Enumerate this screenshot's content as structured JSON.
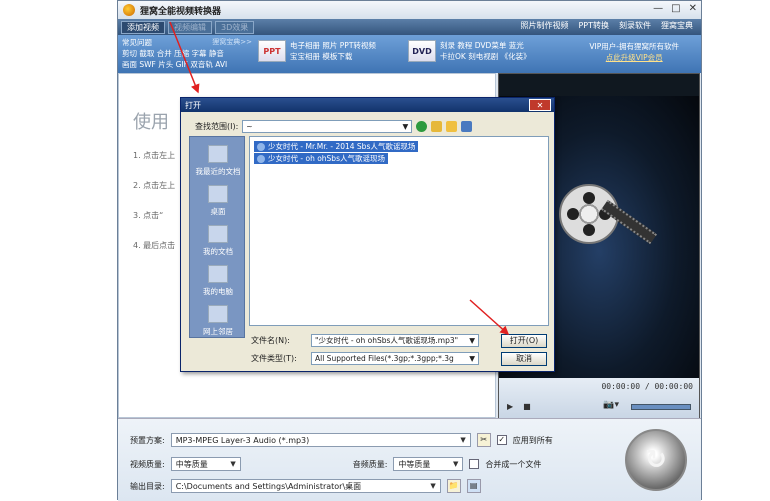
{
  "window": {
    "title": "狸窝全能视频转换器",
    "controls": [
      "—",
      "□",
      "✕"
    ]
  },
  "tabs": [
    {
      "label": "添加视频"
    },
    {
      "label": "视频编辑"
    },
    {
      "label": "3D效果"
    }
  ],
  "top_links": [
    "照片制作视频",
    "PPT转换",
    "刻录软件",
    "狸窝宝典"
  ],
  "banner": {
    "faq_title": "常见问题",
    "faq_more": "狸窝宝典>>",
    "faq_lines": [
      "剪切 截取 合并 压缩 字幕 静音",
      "画面 SWF 片头 GIF 双音轨 AVI"
    ],
    "promo1": {
      "icon": "PPT",
      "lines": [
        "电子相册 照片 PPT转视频",
        "宝宝相册 模板下载"
      ]
    },
    "promo2": {
      "icon": "DVD",
      "lines": [
        "刻录 教程 DVD菜单 蓝光",
        "卡拉OK 刻电视剧 《化装》"
      ]
    },
    "vip": {
      "line1": "VIP用户-拥有狸窝所有软件",
      "line2": "点此升级VIP会员"
    }
  },
  "left": {
    "title": "使用",
    "steps": [
      "1. 点击左上",
      "2. 点击左上",
      "3. 点击“",
      "4. 最后点击"
    ]
  },
  "player": {
    "time": "00:00:00 / 00:00:00",
    "play": "▶",
    "stop": "■",
    "camera": "📷▾"
  },
  "bottom": {
    "preset_label": "预置方案:",
    "preset_value": "MP3-MPEG Layer-3 Audio (*.mp3)",
    "apply_all": "应用到所有",
    "video_quality_label": "视频质量:",
    "video_quality_value": "中等质量",
    "audio_quality_label": "音频质量:",
    "audio_quality_value": "中等质量",
    "merge_label": "合并成一个文件",
    "output_label": "输出目录:",
    "output_value": "C:\\Documents and Settings\\Administrator\\桌面"
  },
  "dialog": {
    "title": "打开",
    "close": "✕",
    "lookin_label": "查找范围(I):",
    "lookin_value": "~",
    "sidebar": [
      "我最近的文档",
      "桌面",
      "我的文档",
      "我的电脑",
      "网上邻居"
    ],
    "files": [
      "少女时代 - Mr.Mr. - 2014 Sbs人气歌谣现场",
      "少女时代 - oh ohSbs人气歌谣现场"
    ],
    "filename_label": "文件名(N):",
    "filename_value": "\"少女时代 - oh ohSbs人气歌谣现场.mp3\"",
    "filetype_label": "文件类型(T):",
    "filetype_value": "All Supported Files(*.3gp;*.3gpp;*.3g",
    "open_button": "打开(O)",
    "cancel_button": "取消"
  }
}
